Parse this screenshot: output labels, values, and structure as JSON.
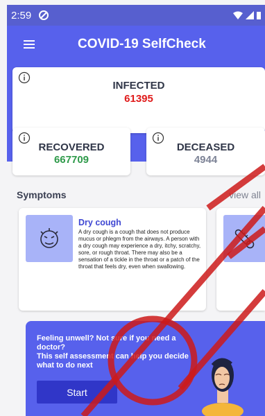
{
  "status_bar": {
    "time": "2:59"
  },
  "app": {
    "title": "COVID-19 SelfCheck"
  },
  "stats": {
    "infected": {
      "label": "INFECTED",
      "value": "61395",
      "color": "#e01b1b"
    },
    "recovered": {
      "label": "RECOVERED",
      "value": "667709",
      "color": "#2e9a4a"
    },
    "deceased": {
      "label": "DECEASED",
      "value": "4944",
      "color": "#7d8396"
    }
  },
  "symptoms": {
    "heading": "Symptoms",
    "view_all": "view all",
    "items": [
      {
        "title": "Dry cough",
        "description": "A dry cough is a cough that does not produce mucus or phlegm from the airways. A person with a dry cough may experience a dry, itchy, scratchy, sore, or rough throat. There may also be a sensation of a tickle in the throat or a patch of the throat that feels dry, even when swallowing.",
        "icon": "cough-face-icon"
      },
      {
        "title": "",
        "icon": "thermometer-icon"
      }
    ]
  },
  "banner": {
    "line1": "Feeling unwell? Not sure if you need a doctor?",
    "line2": "This self assessment can help you decide what to do next",
    "start_label": "Start"
  },
  "colors": {
    "primary": "#5761ec",
    "primary_dark": "#3036c8",
    "light_accent": "#a8b3f8",
    "title_blue": "#3f47d2"
  }
}
